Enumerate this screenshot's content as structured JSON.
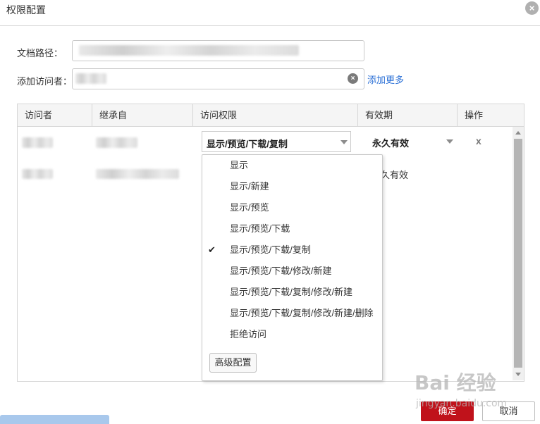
{
  "dialog": {
    "title": "权限配置",
    "close_glyph": "×"
  },
  "form": {
    "doc_path_label": "文档路径：",
    "add_visitor_label": "添加访问者：",
    "add_more_link": "添加更多",
    "clear_glyph": "×"
  },
  "table": {
    "headers": [
      "访问者",
      "继承自",
      "访问权限",
      "有效期",
      "操作"
    ],
    "rows": [
      {
        "permission": "显示/预览/下载/复制",
        "validity": "永久有效",
        "action": "x"
      },
      {
        "validity": "久有效"
      }
    ]
  },
  "dropdown": {
    "options": [
      {
        "label": "显示",
        "checked": false
      },
      {
        "label": "显示/新建",
        "checked": false
      },
      {
        "label": "显示/预览",
        "checked": false
      },
      {
        "label": "显示/预览/下载",
        "checked": false
      },
      {
        "label": "显示/预览/下载/复制",
        "checked": true
      },
      {
        "label": "显示/预览/下载/修改/新建",
        "checked": false
      },
      {
        "label": "显示/预览/下载/复制/修改/新建",
        "checked": false
      },
      {
        "label": "显示/预览/下载/复制/修改/新建/删除",
        "checked": false
      },
      {
        "label": "拒绝访问",
        "checked": false
      }
    ],
    "check_glyph": "✔",
    "advanced_label": "高级配置"
  },
  "footer": {
    "ok_label": "确定",
    "cancel_label": "取消"
  },
  "watermark": {
    "logo": "Bai 经验",
    "url": "jingyan.baidu.com"
  },
  "colors": {
    "primary": "#c0121b",
    "link": "#2a6fd6"
  }
}
